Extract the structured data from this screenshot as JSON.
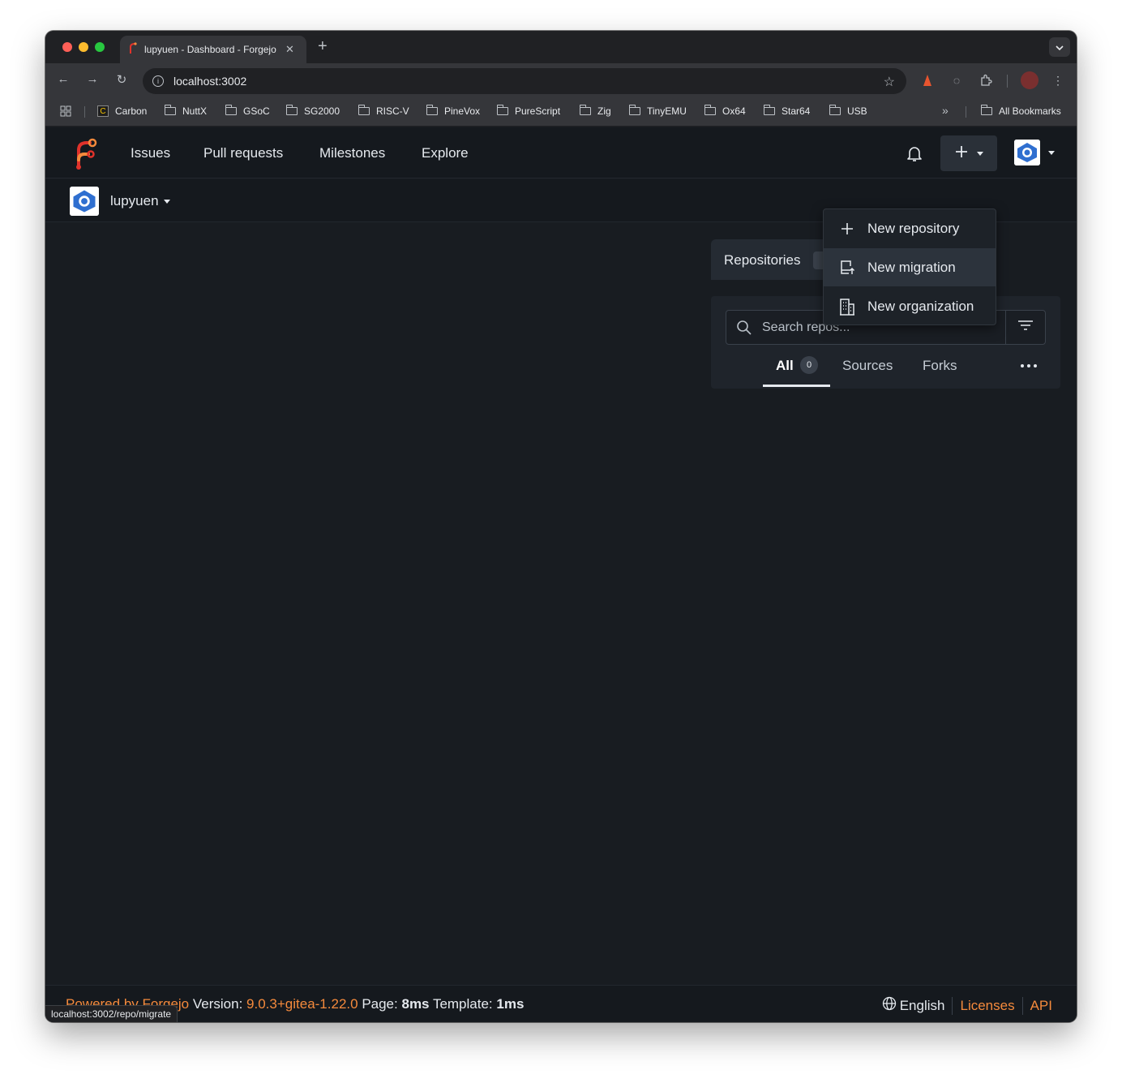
{
  "browser": {
    "tab_title": "lupyuen - Dashboard - Forgejo",
    "url": "localhost:3002",
    "bookmarks": [
      "Carbon",
      "NuttX",
      "GSoC",
      "SG2000",
      "RISC-V",
      "PineVox",
      "PureScript",
      "Zig",
      "TinyEMU",
      "Ox64",
      "Star64",
      "USB"
    ],
    "all_bookmarks": "All Bookmarks",
    "status_url": "localhost:3002/repo/migrate"
  },
  "nav": {
    "links": [
      "Issues",
      "Pull requests",
      "Milestones",
      "Explore"
    ]
  },
  "context": {
    "user": "lupyuen"
  },
  "create_menu": {
    "items": [
      "New repository",
      "New migration",
      "New organization"
    ],
    "hovered": "New migration"
  },
  "repos": {
    "tab_label": "Repositories",
    "search_placeholder": "Search repos...",
    "filters": [
      "All",
      "Sources",
      "Forks"
    ],
    "all_count": "0"
  },
  "footer": {
    "powered_by": "Powered by Forgejo",
    "version_label": "Version:",
    "version": "9.0.3+gitea-1.22.0",
    "page_label": "Page:",
    "page_time": "8ms",
    "template_label": "Template:",
    "template_time": "1ms",
    "language": "English",
    "licenses": "Licenses",
    "api": "API"
  },
  "colors": {
    "accent": "#f58a3c",
    "page_bg": "#181c21",
    "nav_bg": "#15191e"
  }
}
